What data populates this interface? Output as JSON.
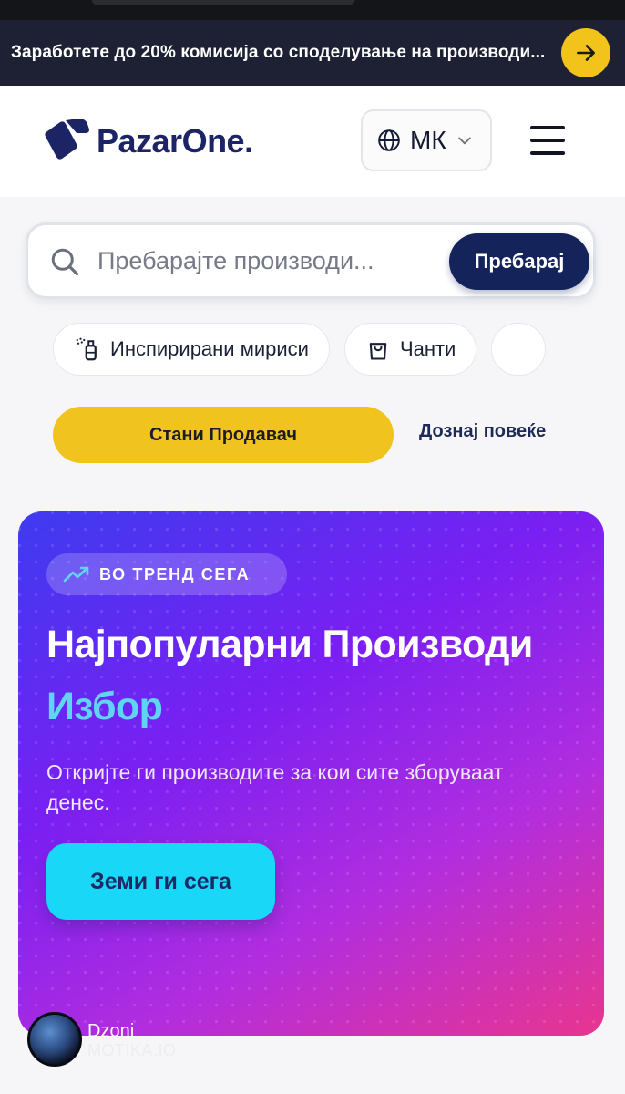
{
  "promo": {
    "text": "Заработете до 20% комисија со споделување на производи...",
    "arrow_icon": "arrow-right-icon"
  },
  "header": {
    "logo_text": "PazarOne.",
    "language": "МК",
    "menu_icon": "hamburger-icon"
  },
  "search": {
    "placeholder": "Пребарајте производи...",
    "button_label": "Пребарај"
  },
  "categories": [
    {
      "label": "Инспирирани мириси",
      "icon": "perfume-icon"
    },
    {
      "label": "Чанти",
      "icon": "bag-icon"
    }
  ],
  "seller": {
    "button_label": "Стани Продавач",
    "learn_more_label": "Дознај повеќе"
  },
  "hero": {
    "badge": "ВО ТРЕНД СЕГА",
    "title": "Најпопуларни Производи",
    "highlight": "Избор",
    "description": "Откријте ги производите за кои сите зборуваат денес.",
    "cta_label": "Земи ги сега"
  },
  "watermark": {
    "name": "Dzoni",
    "site": "MOTIKA.IO"
  },
  "colors": {
    "accent_yellow": "#f2c31b",
    "navy": "#14245a",
    "cyan": "#19d7f7",
    "hero_start": "#3d3bf0",
    "hero_end": "#e8358f"
  }
}
